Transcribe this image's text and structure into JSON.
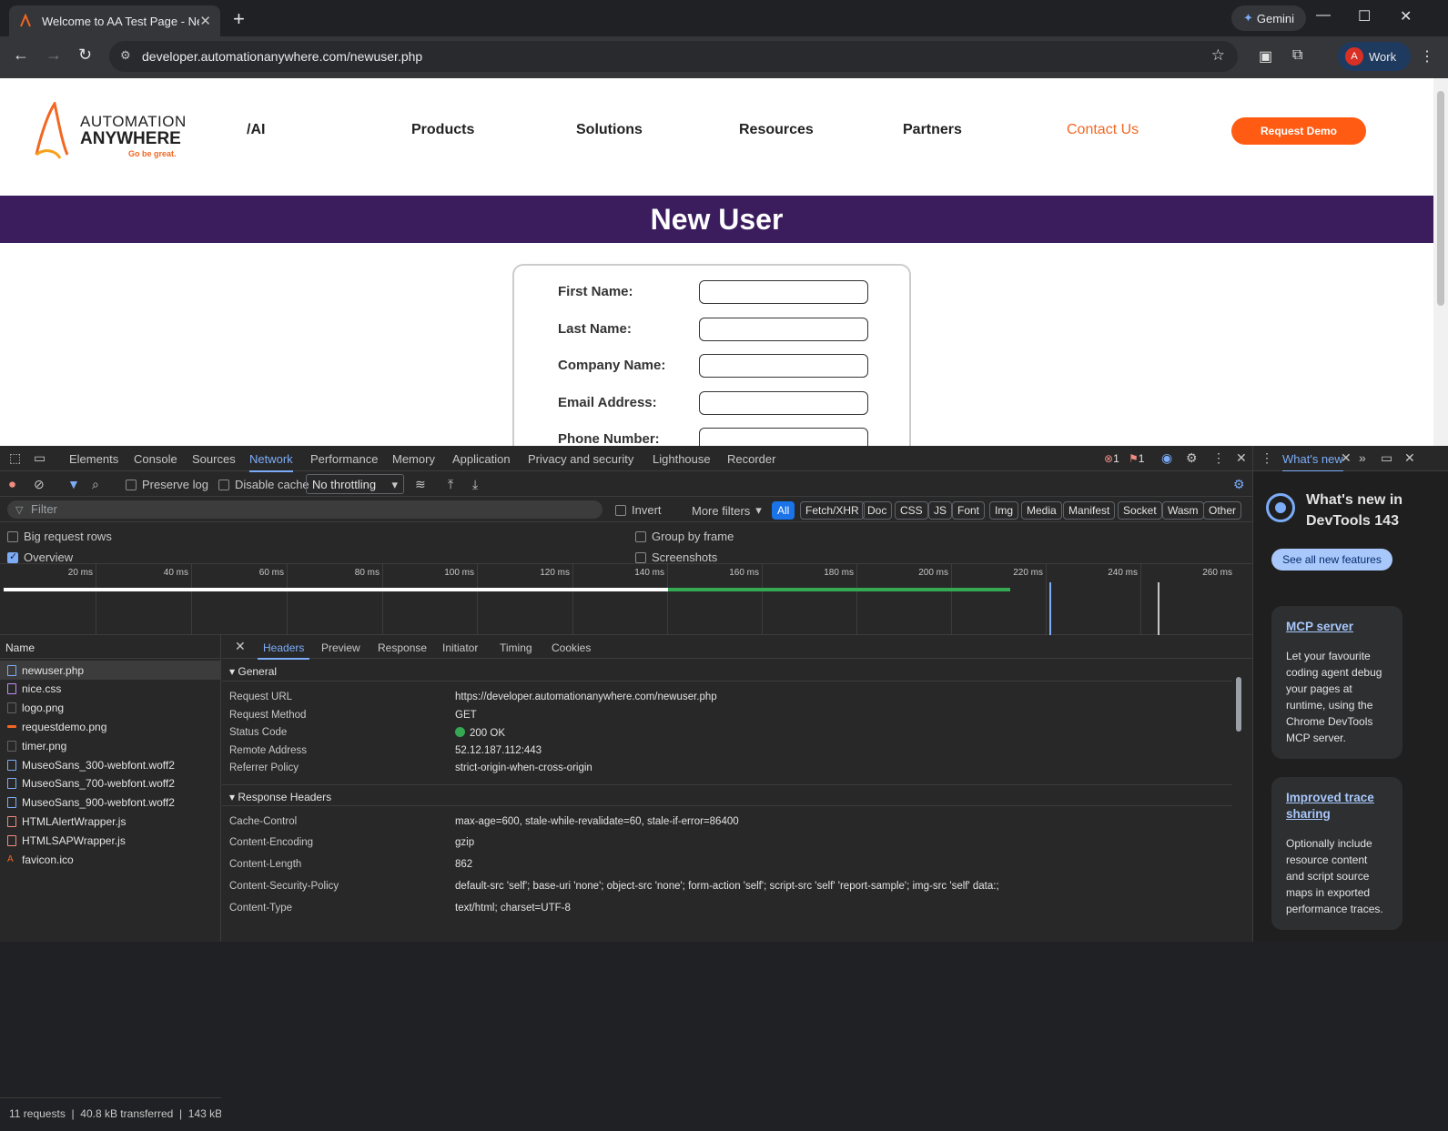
{
  "browser": {
    "tab_title": "Welcome to AA Test Page - New",
    "gemini_label": "Gemini",
    "url": "developer.automationanywhere.com/newuser.php",
    "profile_initial": "A",
    "profile_label": "Work"
  },
  "site": {
    "logo_line1": "AUTOMATION",
    "logo_line2": "ANYWHERE",
    "logo_tagline": "Go be great.",
    "nav": [
      "/AI",
      "Products",
      "Solutions",
      "Resources",
      "Partners",
      "Contact Us"
    ],
    "demo_button": "Request Demo",
    "banner_title": "New User",
    "form_fields": [
      "First Name:",
      "Last Name:",
      "Company Name:",
      "Email Address:",
      "Phone Number:"
    ],
    "accent_color": "#f26722",
    "banner_color": "#3b1d5e"
  },
  "devtools": {
    "tabs": [
      "Elements",
      "Console",
      "Sources",
      "Network",
      "Performance",
      "Memory",
      "Application",
      "Privacy and security",
      "Lighthouse",
      "Recorder"
    ],
    "active_tab": "Network",
    "error_count": "1",
    "issue_count": "1",
    "preserve_log": "Preserve log",
    "disable_cache": "Disable cache",
    "throttling": "No throttling",
    "filter_placeholder": "Filter",
    "invert": "Invert",
    "more_filters": "More filters",
    "type_filters": [
      "All",
      "Fetch/XHR",
      "Doc",
      "CSS",
      "JS",
      "Font",
      "Img",
      "Media",
      "Manifest",
      "Socket",
      "Wasm",
      "Other"
    ],
    "options": {
      "big_rows": "Big request rows",
      "overview": "Overview",
      "group_by_frame": "Group by frame",
      "screenshots": "Screenshots"
    },
    "timeline_ticks": [
      "20 ms",
      "40 ms",
      "60 ms",
      "80 ms",
      "100 ms",
      "120 ms",
      "140 ms",
      "160 ms",
      "180 ms",
      "200 ms",
      "220 ms",
      "240 ms",
      "260 ms"
    ],
    "name_header": "Name",
    "requests": [
      {
        "name": "newuser.php",
        "type": "doc"
      },
      {
        "name": "nice.css",
        "type": "css"
      },
      {
        "name": "logo.png",
        "type": "img"
      },
      {
        "name": "requestdemo.png",
        "type": "demo-ic"
      },
      {
        "name": "timer.png",
        "type": "img"
      },
      {
        "name": "MuseoSans_300-webfont.woff2",
        "type": "font"
      },
      {
        "name": "MuseoSans_700-webfont.woff2",
        "type": "font"
      },
      {
        "name": "MuseoSans_900-webfont.woff2",
        "type": "font"
      },
      {
        "name": "HTMLAlertWrapper.js",
        "type": "js"
      },
      {
        "name": "HTMLSAPWrapper.js",
        "type": "js"
      },
      {
        "name": "favicon.ico",
        "type": "ico"
      }
    ],
    "status_requests": "11 requests",
    "status_transferred": "40.8 kB transferred",
    "status_resources": "143 kB",
    "detail_tabs": [
      "Headers",
      "Preview",
      "Response",
      "Initiator",
      "Timing",
      "Cookies"
    ],
    "general_title": "General",
    "general": [
      {
        "k": "Request URL",
        "v": "https://developer.automationanywhere.com/newuser.php"
      },
      {
        "k": "Request Method",
        "v": "GET"
      },
      {
        "k": "Status Code",
        "v": "200 OK"
      },
      {
        "k": "Remote Address",
        "v": "52.12.187.112:443"
      },
      {
        "k": "Referrer Policy",
        "v": "strict-origin-when-cross-origin"
      }
    ],
    "response_title": "Response Headers",
    "response": [
      {
        "k": "Cache-Control",
        "v": "max-age=600, stale-while-revalidate=60, stale-if-error=86400"
      },
      {
        "k": "Content-Encoding",
        "v": "gzip"
      },
      {
        "k": "Content-Length",
        "v": "862"
      },
      {
        "k": "Content-Security-Policy",
        "v": "default-src 'self'; base-uri 'none'; object-src 'none'; form-action 'self'; script-src 'self' 'report-sample'; img-src 'self' data:;"
      },
      {
        "k": "Content-Type",
        "v": "text/html; charset=UTF-8"
      }
    ]
  },
  "whats_new": {
    "tab_label": "What's new",
    "title": "What's new in DevTools 143",
    "see_all": "See all new features",
    "cards": [
      {
        "title": "MCP server",
        "body": "Let your favourite coding agent debug your pages at runtime, using the Chrome DevTools MCP server."
      },
      {
        "title": "Improved trace sharing",
        "body": "Optionally include resource content and script source maps in exported performance traces."
      }
    ]
  }
}
